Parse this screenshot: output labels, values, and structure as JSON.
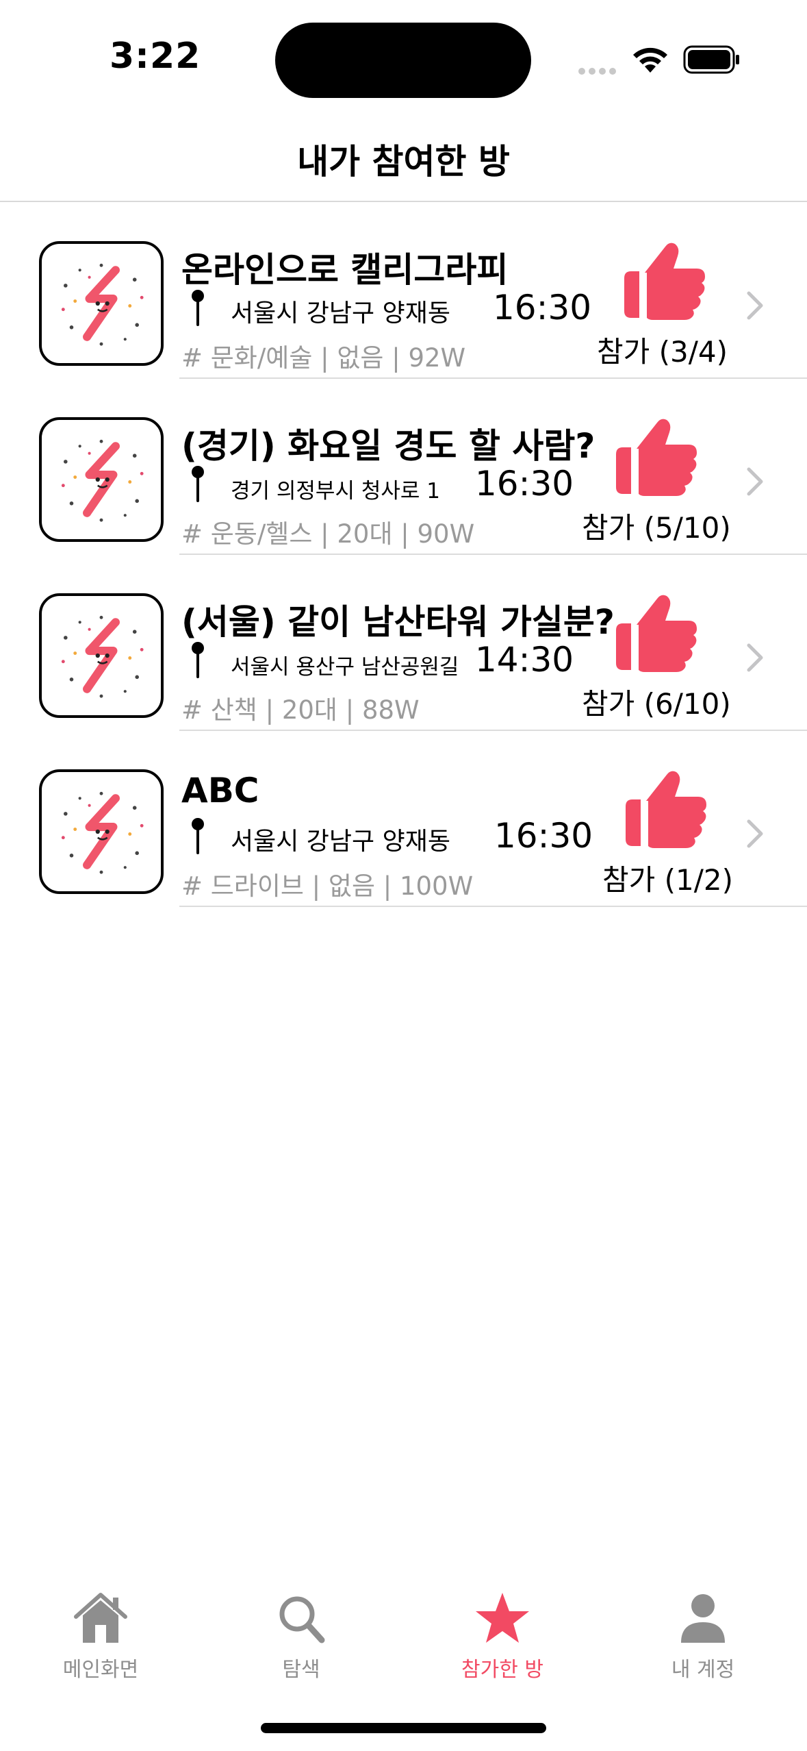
{
  "status_bar": {
    "time": "3:22"
  },
  "header": {
    "title": "내가 참여한 방"
  },
  "colors": {
    "accent": "#f24a63",
    "like": "#f24a63",
    "muted": "#9a9a9a",
    "tab_inactive": "#8e8e8e"
  },
  "rooms": [
    {
      "title": "온라인으로 캘리그라피",
      "location": "서울시 강남구 양재동",
      "time": "16:30",
      "tags": "# 문화/예술 | 없음 | 92W",
      "count": "참가 (3/4)",
      "icon": "thumbs-up-icon"
    },
    {
      "title": "(경기) 화요일 경도 할 사람?",
      "location": "경기 의정부시 청사로 1",
      "time": "16:30",
      "tags": "# 운동/헬스 | 20대 | 90W",
      "count": "참가 (5/10)",
      "icon": "thumbs-up-icon"
    },
    {
      "title": "(서울) 같이 남산타워 가실분?",
      "location": "서울시 용산구 남산공원길",
      "time": "14:30",
      "tags": "# 산책 | 20대 | 88W",
      "count": "참가 (6/10)",
      "icon": "thumbs-up-icon"
    },
    {
      "title": "ABC",
      "location": "서울시 강남구 양재동",
      "time": "16:30",
      "tags": "# 드라이브 | 없음 | 100W",
      "count": "참가 (1/2)",
      "icon": "thumbs-up-icon"
    }
  ],
  "tab_bar": {
    "tabs": [
      {
        "label": "메인화면",
        "icon": "home-icon"
      },
      {
        "label": "탐색",
        "icon": "search-icon"
      },
      {
        "label": "참가한 방",
        "icon": "star-icon",
        "active": true
      },
      {
        "label": "내 계정",
        "icon": "person-icon"
      }
    ]
  }
}
